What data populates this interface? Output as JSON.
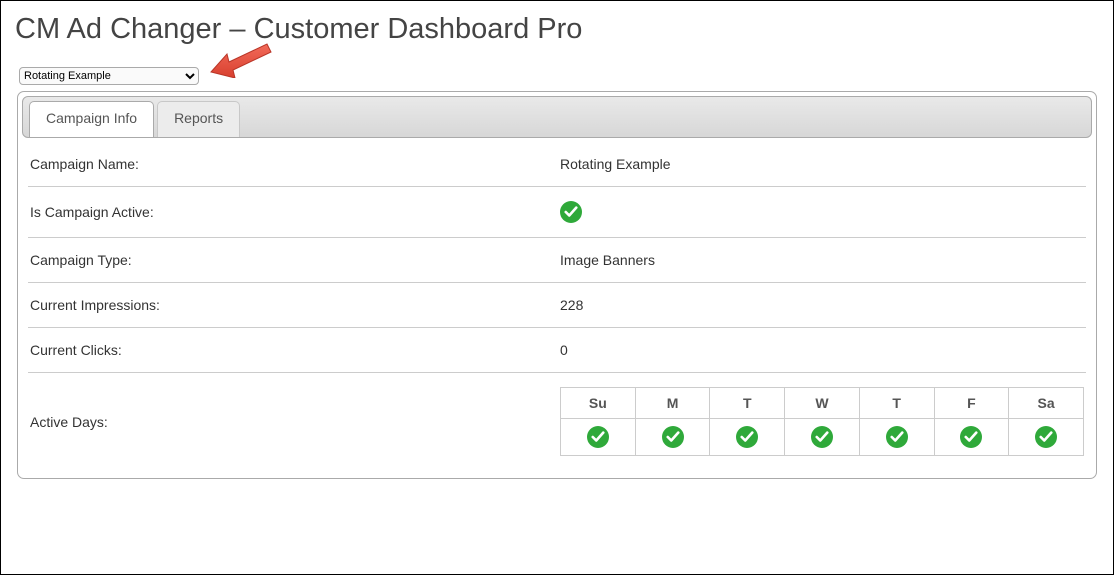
{
  "header": {
    "title": "CM Ad Changer – Customer Dashboard Pro"
  },
  "selector": {
    "selected": "Rotating Example"
  },
  "tabs": [
    {
      "label": "Campaign Info",
      "active": true
    },
    {
      "label": "Reports",
      "active": false
    }
  ],
  "info": {
    "campaign_name": {
      "label": "Campaign Name:",
      "value": "Rotating Example"
    },
    "is_active": {
      "label": "Is Campaign Active:",
      "value": true
    },
    "campaign_type": {
      "label": "Campaign Type:",
      "value": "Image Banners"
    },
    "impressions": {
      "label": "Current Impressions:",
      "value": "228"
    },
    "clicks": {
      "label": "Current Clicks:",
      "value": "0"
    },
    "active_days": {
      "label": "Active Days:",
      "headers": [
        "Su",
        "M",
        "T",
        "W",
        "T",
        "F",
        "Sa"
      ],
      "values": [
        true,
        true,
        true,
        true,
        true,
        true,
        true
      ]
    }
  },
  "colors": {
    "check": "#2fa93a",
    "arrow": "#e84d3d"
  }
}
